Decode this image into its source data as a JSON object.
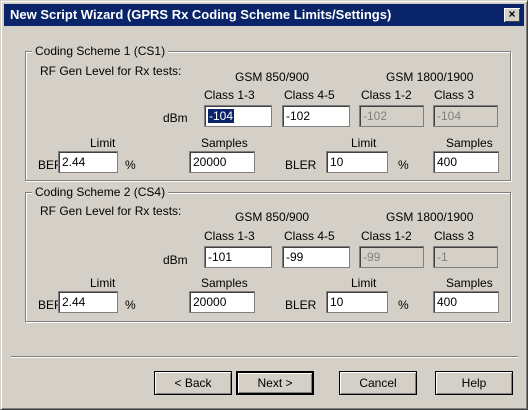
{
  "window": {
    "title": "New Script Wizard (GPRS Rx Coding Scheme Limits/Settings)",
    "close_glyph": "×"
  },
  "cs1": {
    "title": "Coding Scheme 1 (CS1)",
    "rf_label": "RF Gen Level for Rx tests:",
    "band1": "GSM 850/900",
    "band2": "GSM 1800/1900",
    "class13": "Class 1-3",
    "class45": "Class 4-5",
    "class12": "Class 1-2",
    "class3": "Class 3",
    "dbm": "dBm",
    "v_class13": "-104",
    "v_class45": "-102",
    "v_class12": "-102",
    "v_class3": "-104",
    "ber_limit_label": "Limit",
    "ber_label": "BER",
    "ber_limit": "2.44",
    "ber_unit": "%",
    "ber_samples_label": "Samples",
    "ber_samples": "20000",
    "bler_limit_label": "Limit",
    "bler_label": "BLER",
    "bler_limit": "10",
    "bler_unit": "%",
    "bler_samples_label": "Samples",
    "bler_samples": "400"
  },
  "cs2": {
    "title": "Coding Scheme 2 (CS4)",
    "rf_label": "RF Gen Level for Rx tests:",
    "band1": "GSM 850/900",
    "band2": "GSM 1800/1900",
    "class13": "Class 1-3",
    "class45": "Class 4-5",
    "class12": "Class 1-2",
    "class3": "Class 3",
    "dbm": "dBm",
    "v_class13": "-101",
    "v_class45": "-99",
    "v_class12": "-99",
    "v_class3": "-1",
    "ber_limit_label": "Limit",
    "ber_label": "BER",
    "ber_limit": "2.44",
    "ber_unit": "%",
    "ber_samples_label": "Samples",
    "ber_samples": "20000",
    "bler_limit_label": "Limit",
    "bler_label": "BLER",
    "bler_limit": "10",
    "bler_unit": "%",
    "bler_samples_label": "Samples",
    "bler_samples": "400"
  },
  "buttons": {
    "back": "< Back",
    "next": "Next >",
    "cancel": "Cancel",
    "help": "Help"
  }
}
